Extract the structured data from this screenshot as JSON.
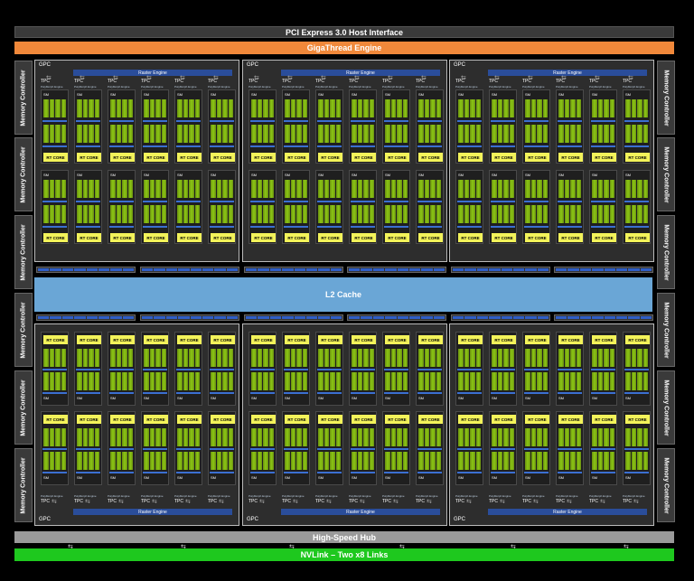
{
  "pci": "PCI Express 3.0 Host Interface",
  "giga": "GigaThread Engine",
  "l2": "L2 Cache",
  "hub": "High-Speed Hub",
  "nvlink": "NVLink – Two x8 Links",
  "memory_controller": "Memory Controller",
  "gpc": "GPC",
  "raster": "Raster Engine",
  "tpc": "TPC",
  "polymorph": "PolyMorph Engine",
  "sm": "SM",
  "rt_core": "RT CORE",
  "colors": {
    "orange": "#f0883a",
    "green": "#1ec81e",
    "l2": "#6aa6d6",
    "rt": "#f3f35a",
    "raster": "#2a4d9a"
  }
}
